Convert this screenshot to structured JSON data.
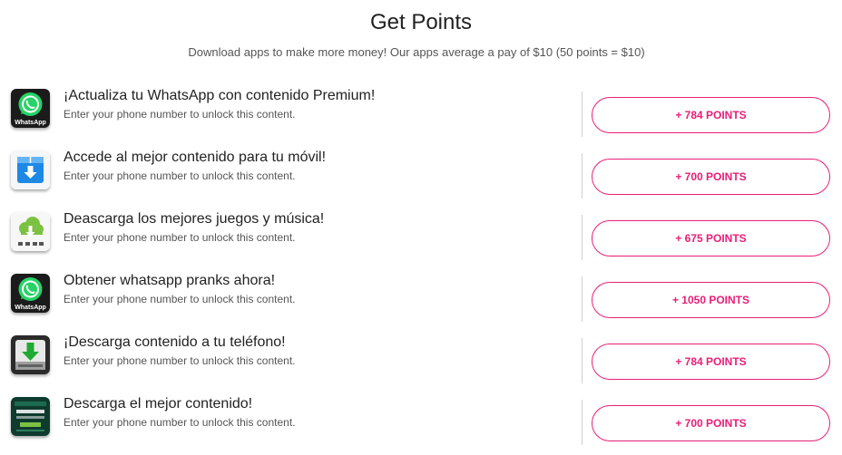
{
  "header": {
    "title": "Get Points",
    "subtitle": "Download apps to make more money! Our apps average a pay of $10 (50 points = $10)"
  },
  "offers": [
    {
      "icon": "whatsapp-icon",
      "title": "¡Actualiza tu WhatsApp con contenido Premium!",
      "subtitle": "Enter your phone number to unlock this content.",
      "points": "+ 784 POINTS",
      "icon_label": "WhatsApp"
    },
    {
      "icon": "download-box-icon",
      "title": "Accede al mejor contenido para tu móvil!",
      "subtitle": "Enter your phone number to unlock this content.",
      "points": "+ 700 POINTS"
    },
    {
      "icon": "cloud-download-icon",
      "title": "Deascarga los mejores juegos y música!",
      "subtitle": "Enter your phone number to unlock this content.",
      "points": "+ 675 POINTS"
    },
    {
      "icon": "whatsapp-icon",
      "title": "Obtener whatsapp pranks ahora!",
      "subtitle": "Enter your phone number to unlock this content.",
      "points": "+ 1050 POINTS",
      "icon_label": "WhatsApp"
    },
    {
      "icon": "drive-download-icon",
      "title": "¡Descarga contenido a tu teléfono!",
      "subtitle": "Enter your phone number to unlock this content.",
      "points": "+ 784 POINTS"
    },
    {
      "icon": "verification-screen-icon",
      "title": "Descarga el mejor contenido!",
      "subtitle": "Enter your phone number to unlock this content.",
      "points": "+ 700 POINTS"
    }
  ],
  "colors": {
    "accent": "#e91e77",
    "whatsapp_green": "#25d366",
    "download_blue": "#1e88e5",
    "cloud_green": "#7cc242"
  }
}
